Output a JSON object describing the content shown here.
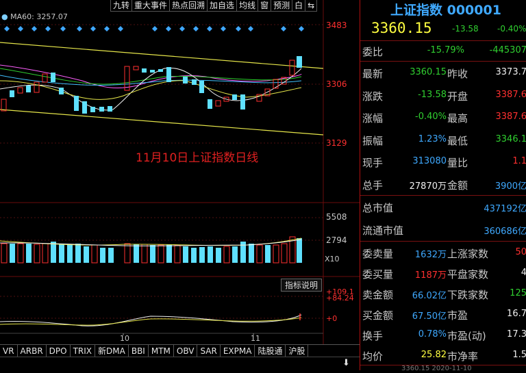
{
  "toolbar": [
    "九转",
    "重大事件",
    "热点回溯",
    "加自选",
    "均线",
    "窗",
    "预测",
    "白",
    "⇆"
  ],
  "ma_legend": "MA60: 3257.07",
  "price_axis": [
    "3483",
    "3306",
    "3129"
  ],
  "volume_axis": [
    "5508",
    "2794",
    "X10"
  ],
  "indicator_axis": [
    "+109.1",
    "+84.24",
    "+0"
  ],
  "indicator_button": "指标说明",
  "date_labels": [
    "10",
    "11"
  ],
  "caption": "11月10日上证指数日线",
  "tabs": [
    "VR",
    "ARBR",
    "DPO",
    "TRIX",
    "新DMA",
    "BBI",
    "MTM",
    "OBV",
    "SAR",
    "EXPMA",
    "陆股通",
    "沪股"
  ],
  "panel": {
    "title": "上证指数 000001",
    "price": "3360.15",
    "change": "-13.58",
    "change_pct": "-0.40%",
    "weibi_label": "委比",
    "weibi_pct": "-15.79%",
    "weibi_val": "-445307",
    "rows": [
      {
        "l1": "最新",
        "v1": "3360.15",
        "c1": "green",
        "l2": "昨收",
        "v2": "3373.7",
        "c2": "white"
      },
      {
        "l1": "涨跌",
        "v1": "-13.58",
        "c1": "green",
        "l2": "开盘",
        "v2": "3387.6",
        "c2": "red"
      },
      {
        "l1": "涨幅",
        "v1": "-0.40%",
        "c1": "green",
        "l2": "最高",
        "v2": "3387.6",
        "c2": "red"
      },
      {
        "l1": "振幅",
        "v1": "1.23%",
        "c1": "cyan",
        "l2": "最低",
        "v2": "3346.1",
        "c2": "green"
      },
      {
        "l1": "现手",
        "v1": "313080",
        "c1": "cyan",
        "l2": "量比",
        "v2": "1.1",
        "c2": "red"
      },
      {
        "l1": "总手",
        "v1": "27870万",
        "c1": "white",
        "l2": "金额",
        "v2": "3900亿",
        "c2": "cyan"
      }
    ],
    "mcap_label": "总市值",
    "mcap_val": "437192亿",
    "float_label": "流通市值",
    "float_val": "360686亿",
    "rows2": [
      {
        "l1": "委卖量",
        "v1": "1632万",
        "c1": "cyan",
        "l2": "上涨家数",
        "v2": "50",
        "c2": "red"
      },
      {
        "l1": "委买量",
        "v1": "1187万",
        "c1": "red",
        "l2": "平盘家数",
        "v2": "4",
        "c2": "white"
      },
      {
        "l1": "卖金额",
        "v1": "66.02亿",
        "c1": "cyan",
        "l2": "下跌家数",
        "v2": "125",
        "c2": "green"
      },
      {
        "l1": "买金额",
        "v1": "67.50亿",
        "c1": "cyan",
        "l2": "市盈",
        "v2": "16.7",
        "c2": "white"
      },
      {
        "l1": "换手",
        "v1": "0.78%",
        "c1": "cyan",
        "l2": "市盈(动)",
        "v2": "17.3",
        "c2": "white"
      },
      {
        "l1": "均价",
        "v1": "25.82",
        "c1": "yellow",
        "l2": "市净率",
        "v2": "1.5",
        "c2": "white"
      }
    ],
    "footer": "3360.15    2020-11-10"
  }
}
